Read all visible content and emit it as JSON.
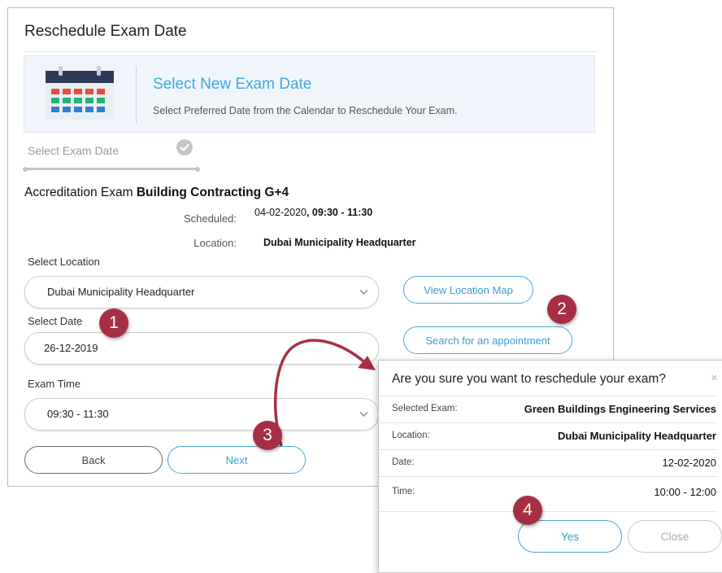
{
  "panel": {
    "title": "Reschedule Exam Date",
    "banner": {
      "icon": "calendar-icon",
      "title": "Select New Exam Date",
      "subtitle": "Select Preferred Date from the Calendar to Reschedule Your Exam."
    },
    "step": {
      "label": "Select Exam Date",
      "icon": "check-circle-icon"
    },
    "exam": {
      "prefix": "Accreditation Exam",
      "name": "Building Contracting G+4",
      "scheduled_label": "Scheduled:",
      "scheduled_value": "04-02-2020",
      "scheduled_time": ", 09:30 - 11:30",
      "location_label": "Location:",
      "location_value": "Dubai Municipality Headquarter"
    },
    "fields": {
      "location_label": "Select Location",
      "location_value": "Dubai Municipality Headquarter",
      "date_label": "Select Date",
      "date_value": "26-12-2019",
      "time_label": "Exam Time",
      "time_value": "09:30 - 11:30"
    },
    "buttons": {
      "view_map": "View Location Map",
      "search": "Search for an appointment",
      "back": "Back",
      "next": "Next"
    }
  },
  "dialog": {
    "title": "Are you sure you want to reschedule your exam?",
    "close_glyph": "×",
    "rows": [
      {
        "key": "Selected Exam:",
        "value": "Green Buildings Engineering Services"
      },
      {
        "key": "Location:",
        "value": "Dubai Municipality Headquarter"
      },
      {
        "key": "Date:",
        "value": "12-02-2020"
      },
      {
        "key": "Time:",
        "value": "10:00 - 12:00"
      }
    ],
    "yes": "Yes",
    "close": "Close"
  },
  "annotations": {
    "badges": [
      "1",
      "2",
      "3",
      "4"
    ],
    "badge_color": "#a72f44",
    "accent_color": "#3fa9dc"
  }
}
